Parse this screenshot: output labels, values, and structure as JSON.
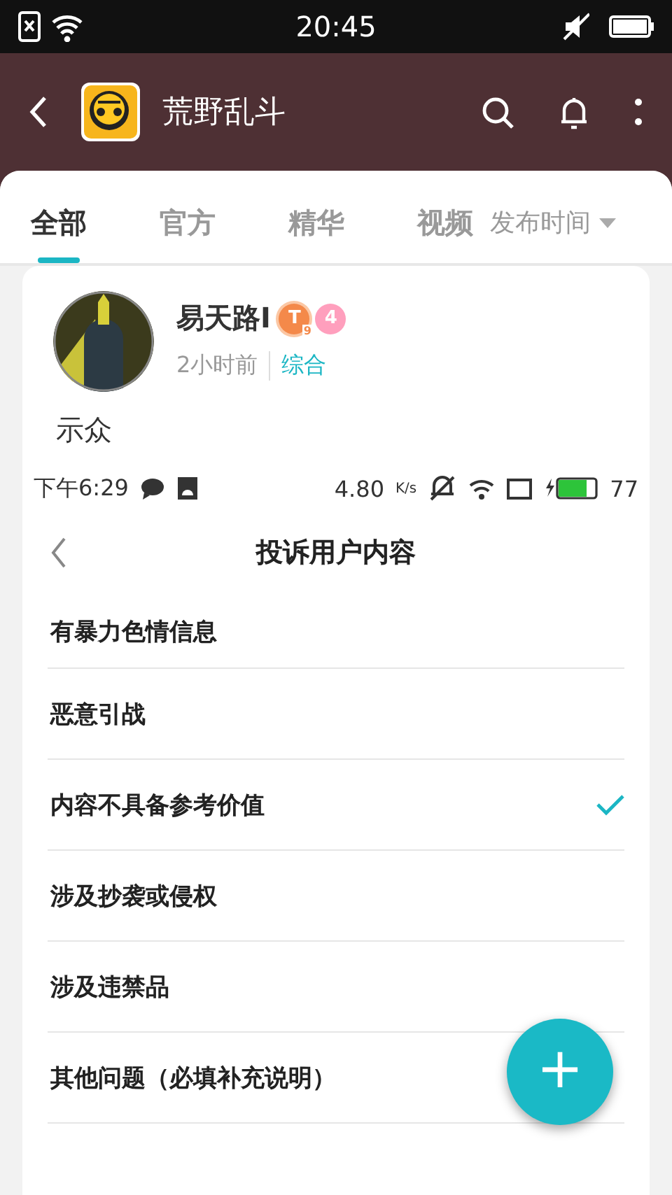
{
  "status_bar": {
    "time": "20:45"
  },
  "header": {
    "title": "荒野乱斗"
  },
  "tabs": [
    {
      "label": "全部",
      "selected": true
    },
    {
      "label": "官方",
      "selected": false
    },
    {
      "label": "精华",
      "selected": false
    },
    {
      "label": "视频",
      "selected": false
    }
  ],
  "sort": {
    "label": "发布时间"
  },
  "post": {
    "author": "易天路I",
    "badges": [
      {
        "kind": "title",
        "text": "T",
        "sub": "9",
        "color": "#f4894a"
      },
      {
        "kind": "level",
        "text": "4",
        "color": "#ff9fbd"
      }
    ],
    "time": "2小时前",
    "category": "综合",
    "body": "示众",
    "screenshot": {
      "status_time": "下午6:29",
      "speed": "4.80",
      "speed_unit": "K/s",
      "battery": "77",
      "title": "投诉用户内容",
      "options": [
        {
          "label": "有暴力色情信息",
          "selected": false
        },
        {
          "label": "恶意引战",
          "selected": false
        },
        {
          "label": "内容不具备参考价值",
          "selected": true
        },
        {
          "label": "涉及抄袭或侵权",
          "selected": false
        },
        {
          "label": "涉及违禁品",
          "selected": false
        },
        {
          "label": "其他问题（必填补充说明）",
          "selected": false
        }
      ]
    }
  },
  "fab": {
    "label": "+"
  }
}
